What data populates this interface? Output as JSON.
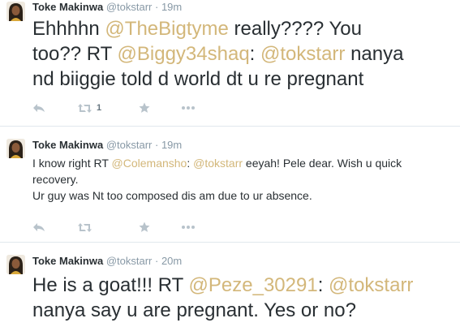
{
  "tweets": [
    {
      "fullname": "Toke Makinwa",
      "username": "@tokstarr",
      "separator": "·",
      "time": "19m",
      "line1": {
        "a": "Ehhhhn ",
        "m1": "@TheBigtyme",
        "b": " really???? You"
      },
      "line2": {
        "a": "too?? RT ",
        "m1": "@Biggy34shaq",
        "b": ": ",
        "m2": "@tokstarr",
        "c": " nanya"
      },
      "line3": {
        "a": "nd biiggie told d world dt u re pregnant"
      },
      "retweet_count": "1"
    },
    {
      "fullname": "Toke Makinwa",
      "username": "@tokstarr",
      "separator": "·",
      "time": "19m",
      "line1": {
        "a": "I know right RT ",
        "m1": "@Colemansho",
        "b": ": ",
        "m2": "@tokstarr",
        "c": " eeyah! Pele dear. Wish u quick"
      },
      "line2": {
        "a": "recovery."
      },
      "line3": {
        "a": "Ur guy was Nt too composed dis am due to ur absence."
      }
    },
    {
      "fullname": "Toke Makinwa",
      "username": "@tokstarr",
      "separator": "·",
      "time": "20m",
      "line1": {
        "a": "He is a goat!!! RT ",
        "m1": "@Peze_30291",
        "b": ": ",
        "m2": "@tokstarr"
      },
      "line2": {
        "a": "nanya say u are pregnant. Yes or no?"
      }
    }
  ],
  "icons": [
    "reply-icon",
    "retweet-icon",
    "favorite-icon",
    "more-icon"
  ],
  "colors": {
    "mention": "#d3b77a",
    "text": "#292f33",
    "muted": "#8899a6",
    "icon": "#b8c3cb",
    "divider": "#e1e8ed"
  }
}
